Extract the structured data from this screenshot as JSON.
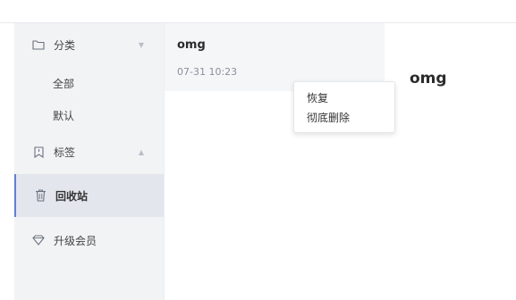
{
  "sidebar": {
    "category": {
      "label": "分类",
      "icon": "folder-icon",
      "arrow": "▼"
    },
    "category_items": [
      "全部",
      "默认"
    ],
    "tags": {
      "label": "标签",
      "icon": "bookmark-icon",
      "arrow": "▲"
    },
    "trash": {
      "label": "回收站",
      "icon": "trash-icon"
    },
    "upgrade": {
      "label": "升级会员",
      "icon": "diamond-icon"
    }
  },
  "note_list": {
    "items": [
      {
        "title": "omg",
        "time": "07-31 10:23"
      }
    ]
  },
  "detail": {
    "title": "omg"
  },
  "context_menu": {
    "items": [
      "恢复",
      "彻底删除"
    ]
  },
  "colors": {
    "accent": "#5b7fe2",
    "sidebar_bg": "#f2f3f5",
    "active_bg": "#e3e6ec"
  }
}
